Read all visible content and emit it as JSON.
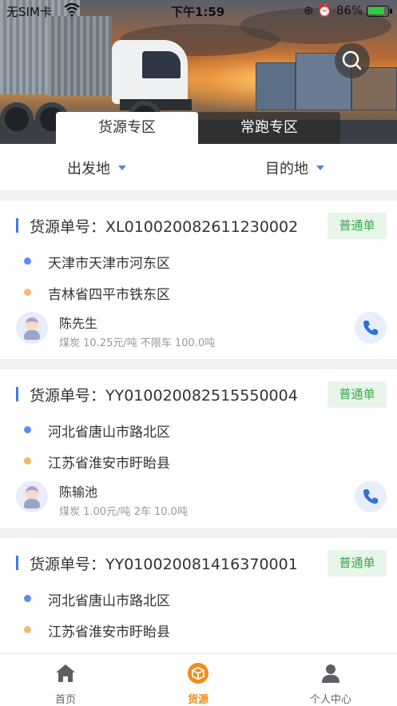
{
  "status_bar": {
    "carrier": "无SIM卡",
    "time": "下午1:59",
    "battery": "86%",
    "battery_level": 0.86
  },
  "tabs": [
    {
      "label": "货源专区",
      "active": true
    },
    {
      "label": "常跑专区",
      "active": false
    }
  ],
  "filters": {
    "origin": "出发地",
    "destination": "目的地"
  },
  "cards": [
    {
      "order_label": "货源单号：XL010020082611230002",
      "badge": "普通单",
      "from": "天津市天津市河东区",
      "to": "吉林省四平市铁东区",
      "contact": "陈先生",
      "detail": "煤炭 10.25元/吨 不限车 100.0吨"
    },
    {
      "order_label": "货源单号：YY010020082515550004",
      "badge": "普通单",
      "from": "河北省唐山市路北区",
      "to": "江苏省淮安市盱眙县",
      "contact": "陈输池",
      "detail": "煤炭 1.00元/吨 2车 10.0吨"
    },
    {
      "order_label": "货源单号：YY010020081416370001",
      "badge": "普通单",
      "from": "河北省唐山市路北区",
      "to": "江苏省淮安市盱眙县"
    }
  ],
  "bottom_nav": [
    {
      "label": "首页",
      "icon": "home-icon",
      "active": false
    },
    {
      "label": "货源",
      "icon": "cargo-box-icon",
      "active": true
    },
    {
      "label": "个人中心",
      "icon": "person-icon",
      "active": false
    }
  ],
  "colors": {
    "accent_blue": "#3b7ddd",
    "origin_dot": "#5b8def",
    "destination_dot": "#f6b86e",
    "badge_green": "#3aa84a",
    "nav_active": "#f08c1a"
  }
}
